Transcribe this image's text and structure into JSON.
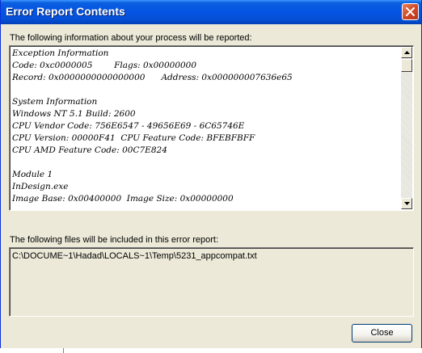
{
  "window": {
    "title": "Error Report Contents",
    "accent_color": "#0554e3",
    "close_icon": "close-x-icon"
  },
  "report": {
    "label": "The following information about your process will be reported:",
    "lines": [
      "Exception Information",
      "Code: 0xc0000005        Flags: 0x00000000",
      "Record: 0x0000000000000000      Address: 0x000000007636e65",
      "",
      "System Information",
      "Windows NT 5.1 Build: 2600",
      "CPU Vendor Code: 756E6547 - 49656E69 - 6C65746E",
      "CPU Version: 00000F41  CPU Feature Code: BFEBFBFF",
      "CPU AMD Feature Code: 00C7E824",
      "",
      "Module 1",
      "InDesign.exe",
      "Image Base: 0x00400000  Image Size: 0x00000000"
    ],
    "scroll_up_icon": "scroll-up-arrow-icon",
    "scroll_down_icon": "scroll-down-arrow-icon"
  },
  "files": {
    "label": "The following files will be included in this error report:",
    "items": [
      "C:\\DOCUME~1\\Hadad\\LOCALS~1\\Temp\\5231_appcompat.txt"
    ]
  },
  "buttons": {
    "close_label": "Close"
  }
}
